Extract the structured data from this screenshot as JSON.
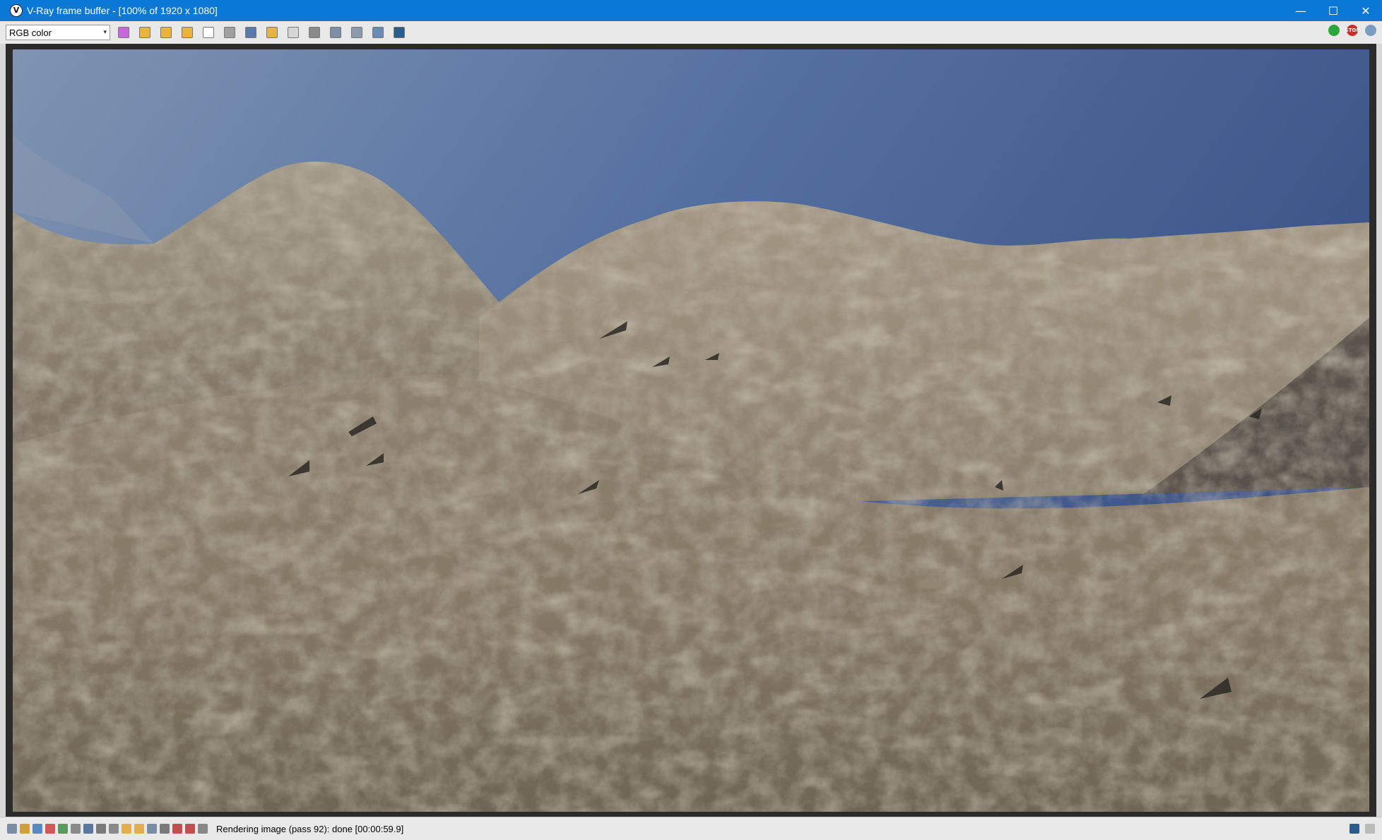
{
  "window": {
    "title": "V-Ray frame buffer - [100% of 1920 x 1080]",
    "app_icon_letter": "V",
    "minimize_glyph": "—",
    "maximize_glyph": "☐",
    "close_glyph": "✕"
  },
  "toolbar": {
    "channel_select": {
      "value": "RGB color",
      "arrow": "▾"
    },
    "buttons": [
      {
        "name": "color-correction-icon",
        "color": "#c66ad9"
      },
      {
        "name": "red-channel-icon",
        "color": "#e8b43a"
      },
      {
        "name": "green-channel-icon",
        "color": "#e8b43a"
      },
      {
        "name": "blue-channel-icon",
        "color": "#e8b43a"
      },
      {
        "name": "alpha-white-icon",
        "color": "#ffffff"
      },
      {
        "name": "monochrome-icon",
        "color": "#a0a0a0"
      },
      {
        "name": "save-image-icon",
        "color": "#5a7aa8"
      },
      {
        "name": "load-image-icon",
        "color": "#e6b24a"
      },
      {
        "name": "clear-image-icon",
        "color": "#d6d6d6"
      },
      {
        "name": "duplicate-vfb-icon",
        "color": "#8a8a8a"
      },
      {
        "name": "track-mouse-icon",
        "color": "#7d8fa6"
      },
      {
        "name": "region-render-icon",
        "color": "#8a9bb0"
      },
      {
        "name": "link-icon",
        "color": "#6a8db5"
      },
      {
        "name": "lens-effects-icon",
        "color": "#2a5c8c"
      }
    ],
    "right_buttons": [
      {
        "name": "render-start-icon",
        "color": "#2aa83a",
        "label": ""
      },
      {
        "name": "stop-render-icon",
        "color": "#d42a2a",
        "label": "STOP"
      },
      {
        "name": "render-settings-icon",
        "color": "#7a9cc0",
        "label": ""
      }
    ]
  },
  "status": {
    "text": "Rendering image (pass 92): done [00:00:59.9]"
  }
}
